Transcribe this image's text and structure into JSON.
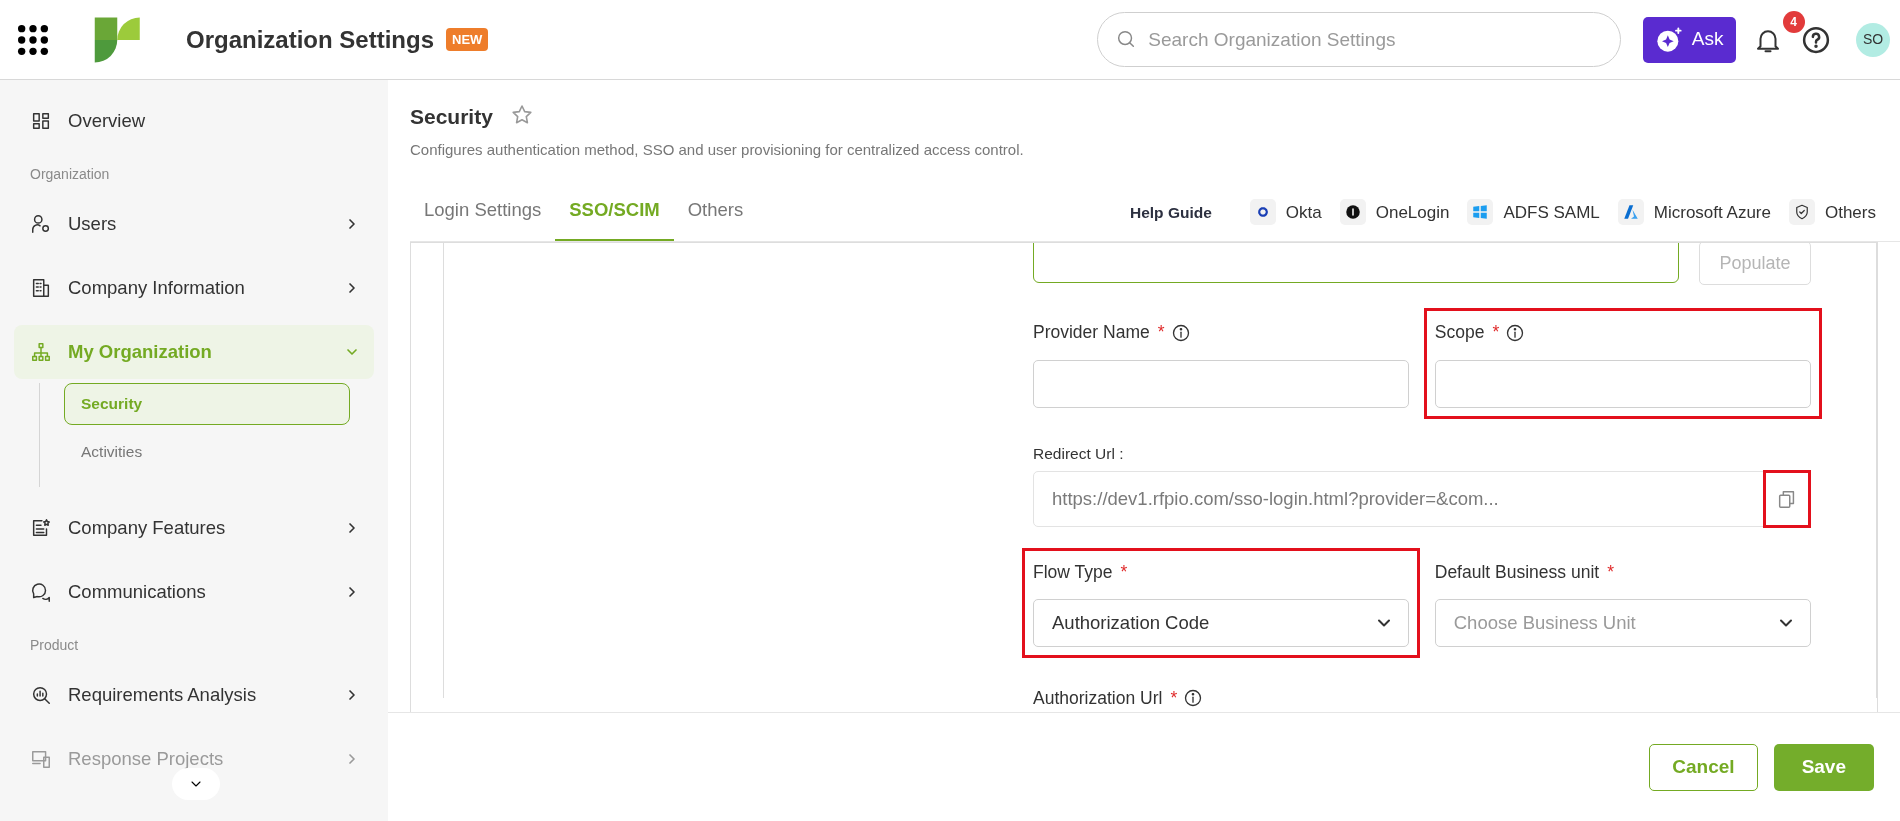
{
  "header": {
    "title": "Organization Settings",
    "badge": "NEW",
    "search": {
      "placeholder": "Search Organization Settings"
    },
    "ask_button": "Ask",
    "notifications": "4",
    "avatar": "SO"
  },
  "sidebar": {
    "items": [
      {
        "kind": "item",
        "label": "Overview",
        "selected": false
      },
      {
        "kind": "section",
        "label": "Organization"
      },
      {
        "kind": "item",
        "label": "Users",
        "selected": false,
        "expanded": false
      },
      {
        "kind": "item",
        "label": "Company Information",
        "selected": false,
        "expanded": false
      },
      {
        "kind": "item",
        "label": "My Organization",
        "selected": true,
        "expanded": true,
        "children": [
          {
            "label": "Security",
            "selected": true
          },
          {
            "label": "Activities",
            "selected": false
          }
        ]
      },
      {
        "kind": "item",
        "label": "Company Features",
        "selected": false,
        "expanded": false
      },
      {
        "kind": "item",
        "label": "Communications",
        "selected": false,
        "expanded": false
      },
      {
        "kind": "section",
        "label": "Product"
      },
      {
        "kind": "item",
        "label": "Requirements Analysis",
        "selected": false,
        "expanded": false
      },
      {
        "kind": "item",
        "label": "Response Projects",
        "selected": false,
        "expanded": false,
        "dimmed": true
      }
    ]
  },
  "page": {
    "title": "Security",
    "starred": false,
    "description": "Configures authentication method, SSO and user provisioning for centralized access control."
  },
  "tabs": [
    {
      "label": "Login Settings",
      "selected": false
    },
    {
      "label": "SSO/SCIM",
      "selected": true
    },
    {
      "label": "Others",
      "selected": false
    }
  ],
  "help_guide": {
    "label": "Help Guide",
    "links": [
      "Okta",
      "OneLogin",
      "ADFS SAML",
      "Microsoft Azure",
      "Others"
    ]
  },
  "form": {
    "top_row": {
      "focused": true,
      "button": "Populate",
      "button_disabled": true
    },
    "fields": [
      {
        "kind": "text",
        "label": "Provider Name",
        "mark": "*",
        "info": true,
        "highlighted": false
      },
      {
        "kind": "text",
        "label": "Scope",
        "mark": "*",
        "info": true,
        "highlighted": true
      },
      {
        "kind": "url",
        "label": "Redirect Url :",
        "value": "https://dev1.rfpio.com/sso-login.html?provider=&com...",
        "copy_highlighted": true
      },
      {
        "kind": "select",
        "label": "Flow Type",
        "mark": "*",
        "value": "Authorization Code",
        "highlighted": true
      },
      {
        "kind": "select",
        "label": "Default Business unit",
        "mark": "*",
        "placeholder": "Choose Business Unit",
        "highlighted": false
      },
      {
        "kind": "label",
        "label": "Authorization Url",
        "mark": "*",
        "info": true
      }
    ]
  },
  "footer": {
    "buttons": [
      {
        "label": "Cancel",
        "kind": "secondary"
      },
      {
        "label": "Save",
        "kind": "primary"
      }
    ]
  }
}
